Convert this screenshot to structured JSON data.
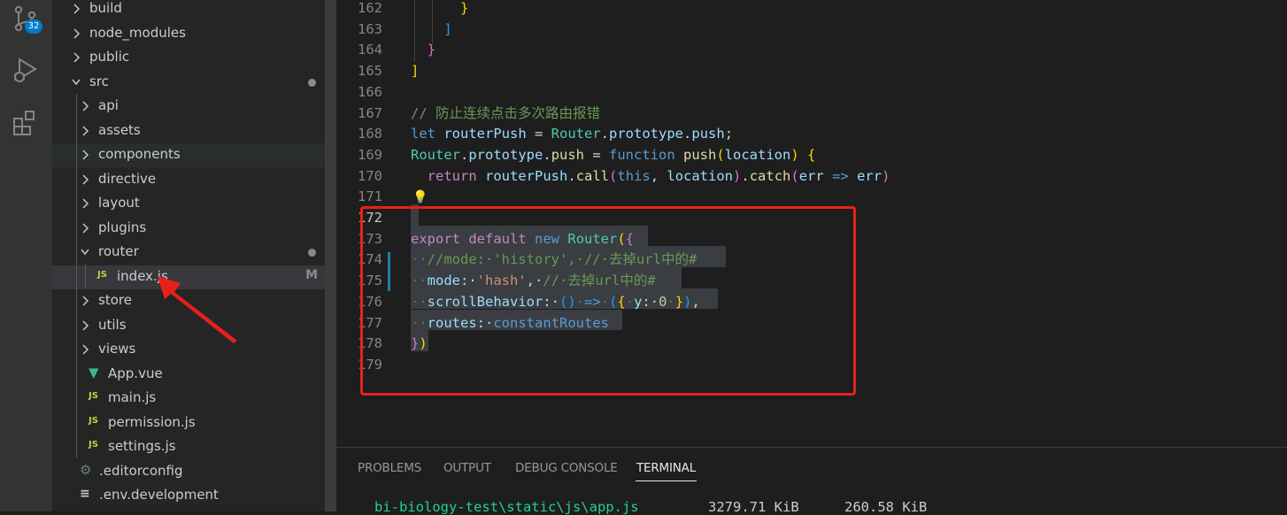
{
  "activity_bar": {
    "scm_badge": "32"
  },
  "explorer": {
    "items": [
      {
        "name": "build",
        "type": "folder",
        "open": false
      },
      {
        "name": "node_modules",
        "type": "folder",
        "open": false
      },
      {
        "name": "public",
        "type": "folder",
        "open": false
      },
      {
        "name": "src",
        "type": "folder",
        "open": true,
        "dot": true
      },
      {
        "name": "api",
        "type": "folder",
        "open": false
      },
      {
        "name": "assets",
        "type": "folder",
        "open": false
      },
      {
        "name": "components",
        "type": "folder",
        "open": false
      },
      {
        "name": "directive",
        "type": "folder",
        "open": false
      },
      {
        "name": "layout",
        "type": "folder",
        "open": false
      },
      {
        "name": "plugins",
        "type": "folder",
        "open": false
      },
      {
        "name": "router",
        "type": "folder",
        "open": true,
        "dot": true
      },
      {
        "name": "index.js",
        "type": "js",
        "badge": "M"
      },
      {
        "name": "store",
        "type": "folder",
        "open": false
      },
      {
        "name": "utils",
        "type": "folder",
        "open": false
      },
      {
        "name": "views",
        "type": "folder",
        "open": false
      },
      {
        "name": "App.vue",
        "type": "vue"
      },
      {
        "name": "main.js",
        "type": "js"
      },
      {
        "name": "permission.js",
        "type": "js"
      },
      {
        "name": "settings.js",
        "type": "js"
      },
      {
        "name": ".editorconfig",
        "type": "gear"
      },
      {
        "name": ".env.development",
        "type": "lines"
      }
    ]
  },
  "editor": {
    "line_numbers": [
      "162",
      "163",
      "164",
      "165",
      "166",
      "167",
      "168",
      "169",
      "170",
      "171",
      "172",
      "173",
      "174",
      "175",
      "176",
      "177",
      "178",
      "179"
    ],
    "active_line": "172",
    "lines": [
      [
        {
          "t": "      ",
          "c": "ws"
        },
        {
          "t": "}",
          "c": "b1"
        }
      ],
      [
        {
          "t": "    ",
          "c": ""
        },
        {
          "t": "]",
          "c": "b3"
        }
      ],
      [
        {
          "t": "  ",
          "c": ""
        },
        {
          "t": "}",
          "c": "b2"
        }
      ],
      [
        {
          "t": "]",
          "c": "b1"
        }
      ],
      [],
      [
        {
          "t": "// 防止连续点击多次路由报错",
          "c": "cmt"
        }
      ],
      [
        {
          "t": "let",
          "c": "k"
        },
        {
          "t": " ",
          "c": ""
        },
        {
          "t": "routerPush",
          "c": "var"
        },
        {
          "t": " = ",
          "c": ""
        },
        {
          "t": "Router",
          "c": "cls"
        },
        {
          "t": ".",
          "c": ""
        },
        {
          "t": "prototype",
          "c": "var"
        },
        {
          "t": ".",
          "c": ""
        },
        {
          "t": "push",
          "c": "var"
        },
        {
          "t": ";",
          "c": ""
        }
      ],
      [
        {
          "t": "Router",
          "c": "cls"
        },
        {
          "t": ".",
          "c": ""
        },
        {
          "t": "prototype",
          "c": "var"
        },
        {
          "t": ".",
          "c": ""
        },
        {
          "t": "push",
          "c": "fn"
        },
        {
          "t": " = ",
          "c": ""
        },
        {
          "t": "function",
          "c": "k"
        },
        {
          "t": " ",
          "c": ""
        },
        {
          "t": "push",
          "c": "fn"
        },
        {
          "t": "(",
          "c": "b1"
        },
        {
          "t": "location",
          "c": "var"
        },
        {
          "t": ")",
          "c": "b1"
        },
        {
          "t": " ",
          "c": ""
        },
        {
          "t": "{",
          "c": "b1"
        }
      ],
      [
        {
          "t": "  ",
          "c": ""
        },
        {
          "t": "return",
          "c": "kw"
        },
        {
          "t": " ",
          "c": ""
        },
        {
          "t": "routerPush",
          "c": "var"
        },
        {
          "t": ".",
          "c": ""
        },
        {
          "t": "call",
          "c": "fn"
        },
        {
          "t": "(",
          "c": "b2"
        },
        {
          "t": "this",
          "c": "k"
        },
        {
          "t": ", ",
          "c": ""
        },
        {
          "t": "location",
          "c": "var"
        },
        {
          "t": ")",
          "c": "b2"
        },
        {
          "t": ".",
          "c": ""
        },
        {
          "t": "catch",
          "c": "fn"
        },
        {
          "t": "(",
          "c": "b2"
        },
        {
          "t": "err",
          "c": "var"
        },
        {
          "t": " ",
          "c": ""
        },
        {
          "t": "=>",
          "c": "k"
        },
        {
          "t": " ",
          "c": ""
        },
        {
          "t": "err",
          "c": "var"
        },
        {
          "t": ")",
          "c": "b2"
        }
      ],
      [
        {
          "t": "💡",
          "c": ""
        }
      ],
      [],
      [
        {
          "t": "export",
          "c": "kw"
        },
        {
          "t": " ",
          "c": "ws"
        },
        {
          "t": "default",
          "c": "kw"
        },
        {
          "t": " ",
          "c": "ws"
        },
        {
          "t": "new",
          "c": "k"
        },
        {
          "t": " ",
          "c": "ws"
        },
        {
          "t": "Router",
          "c": "cls"
        },
        {
          "t": "(",
          "c": "b1"
        },
        {
          "t": "{",
          "c": "b2"
        }
      ],
      [
        {
          "t": "··",
          "c": "ws"
        },
        {
          "t": "//mode:·'history',·//·去掉url中的#",
          "c": "cmt"
        }
      ],
      [
        {
          "t": "··",
          "c": "ws"
        },
        {
          "t": "mode",
          "c": "var"
        },
        {
          "t": ":·",
          "c": ""
        },
        {
          "t": "'hash'",
          "c": "str"
        },
        {
          "t": ",·",
          "c": ""
        },
        {
          "t": "//·去掉url中的#",
          "c": "cmt"
        }
      ],
      [
        {
          "t": "··",
          "c": "ws"
        },
        {
          "t": "scrollBehavior",
          "c": "var"
        },
        {
          "t": ":·",
          "c": ""
        },
        {
          "t": "()",
          "c": "b3"
        },
        {
          "t": "·",
          "c": "ws"
        },
        {
          "t": "=>",
          "c": "k"
        },
        {
          "t": "·",
          "c": "ws"
        },
        {
          "t": "(",
          "c": "b3"
        },
        {
          "t": "{",
          "c": "b1"
        },
        {
          "t": "·",
          "c": "ws"
        },
        {
          "t": "y",
          "c": "var"
        },
        {
          "t": ":·",
          "c": ""
        },
        {
          "t": "0",
          "c": "num"
        },
        {
          "t": "·",
          "c": "ws"
        },
        {
          "t": "}",
          "c": "b1"
        },
        {
          "t": ")",
          "c": "b3"
        },
        {
          "t": ",",
          "c": ""
        }
      ],
      [
        {
          "t": "··",
          "c": "ws"
        },
        {
          "t": "routes",
          "c": "var"
        },
        {
          "t": ":·",
          "c": ""
        },
        {
          "t": "constantRoutes",
          "c": "k"
        }
      ],
      [
        {
          "t": "}",
          "c": "b2"
        },
        {
          "t": ")",
          "c": "b1"
        }
      ],
      []
    ]
  },
  "panel": {
    "tabs": [
      "PROBLEMS",
      "OUTPUT",
      "DEBUG CONSOLE",
      "TERMINAL"
    ],
    "active_tab": "TERMINAL",
    "terminal_line": {
      "path": "bi-biology-test\\static\\js\\app.js",
      "size": "3279.71 KiB",
      "gzip": "260.58 KiB"
    }
  },
  "colors": {
    "annotation_red": "#e8201c",
    "badge_blue": "#007acc"
  }
}
